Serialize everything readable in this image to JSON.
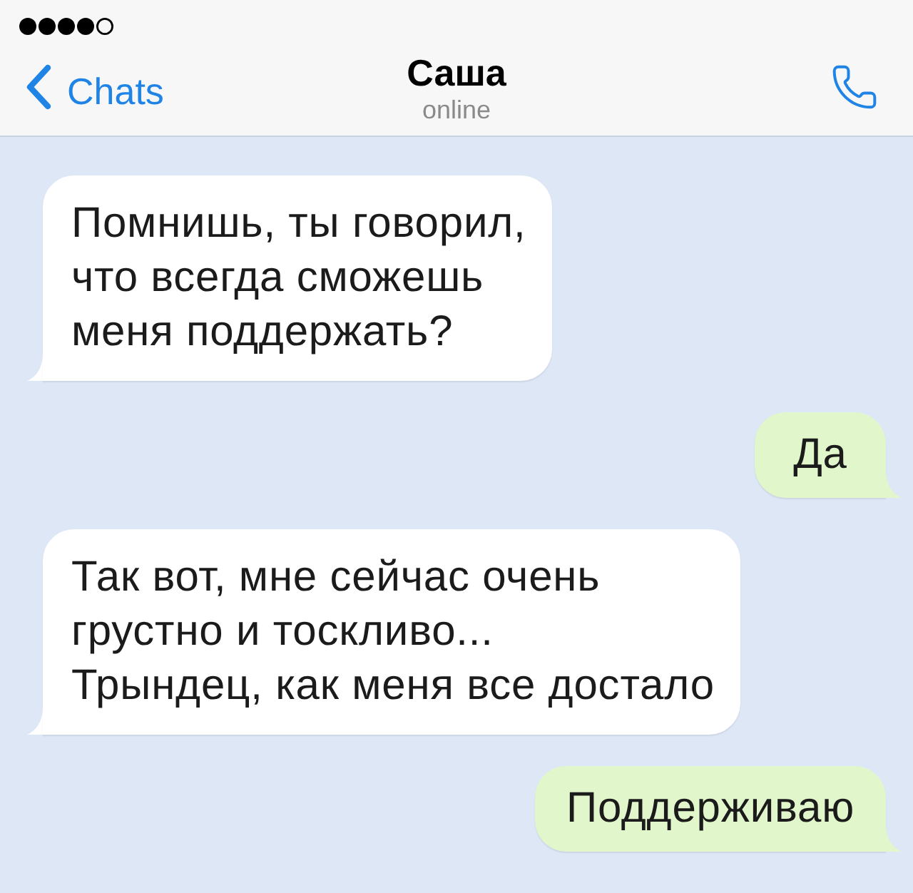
{
  "header": {
    "back": {
      "label": "Chats"
    },
    "title": "Саша",
    "status": "online"
  },
  "messages": [
    {
      "kind": "incoming",
      "lines": [
        "Помнишь, ты говорил,",
        "что всегда сможешь",
        "меня поддержать?"
      ]
    },
    {
      "kind": "outgoing",
      "lines": [
        "Да"
      ]
    },
    {
      "kind": "incoming",
      "lines": [
        "Так вот, мне сейчас очень",
        "грустно и тоскливо...",
        "Трындец, как меня все достало"
      ]
    },
    {
      "kind": "outgoing",
      "lines": [
        "Поддерживаю"
      ]
    }
  ]
}
